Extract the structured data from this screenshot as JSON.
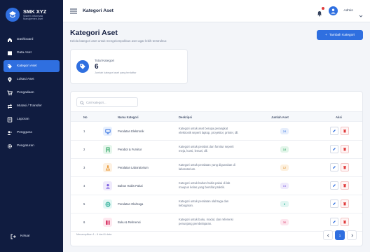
{
  "brand": {
    "name": "SMK XYZ",
    "subtitle_line1": "Sistem Informasi",
    "subtitle_line2": "Manajemen Aset"
  },
  "sidebar": {
    "items": [
      {
        "label": "Dashboard",
        "icon": "home-icon"
      },
      {
        "label": "Data Aset",
        "icon": "box-icon"
      },
      {
        "label": "Kategori Aset",
        "icon": "tag-icon",
        "active": true
      },
      {
        "label": "Lokasi Aset",
        "icon": "location-icon"
      },
      {
        "label": "Pengadaan",
        "icon": "cart-icon"
      },
      {
        "label": "Mutasi / Transfer",
        "icon": "transfer-icon"
      },
      {
        "label": "Laporan",
        "icon": "report-icon"
      },
      {
        "label": "Pengguna",
        "icon": "users-icon"
      },
      {
        "label": "Pengaturan",
        "icon": "gear-icon"
      }
    ],
    "logout": "Keluar"
  },
  "topbar": {
    "title": "Kategori Aset",
    "user": "Admin"
  },
  "page": {
    "title": "Kategori Aset",
    "subtitle": "Kelola kategori aset untuk mengelompokkan aset agar lebih terstruktur.",
    "add_button": "Tambah Kategori"
  },
  "stat": {
    "label": "Total Kategori",
    "value": "6",
    "desc": "Jumlah kategori aset yang terdaftar"
  },
  "search": {
    "placeholder": "Cari kategori..."
  },
  "table": {
    "headers": {
      "no": "No",
      "name": "Nama Kategori",
      "desc": "Deskripsi",
      "count": "Jumlah Aset",
      "actions": "Aksi"
    },
    "rows": [
      {
        "no": "1",
        "name": "Peralatan Elektronik",
        "desc": "Kategori untuk aset berupa perangkat elektronik seperti laptop, proyektor, printer, dll.",
        "count": "24",
        "icon_color": "#e8f0fe",
        "icon_fg": "#2f6fe0",
        "badge_bg": "#e6eefc",
        "badge_fg": "#2f6fe0"
      },
      {
        "no": "2",
        "name": "Perabot & Furnitur",
        "desc": "Kategori untuk perabot dan furnitur seperti meja, kursi, lemari, dll.",
        "count": "18",
        "icon_color": "#e6f6ec",
        "icon_fg": "#22a35a",
        "badge_bg": "#e2f5e9",
        "badge_fg": "#22a35a"
      },
      {
        "no": "3",
        "name": "Peralatan Laboratorium",
        "desc": "Kategori untuk peralatan yang digunakan di laboratorium.",
        "count": "12",
        "icon_color": "#fdf1e2",
        "icon_fg": "#e8942a",
        "badge_bg": "#fdf0de",
        "badge_fg": "#d9831c"
      },
      {
        "no": "4",
        "name": "Bahan Habis Pakai",
        "desc": "Kategori untuk bahan habis pakai di lab maupun kelas yang bersifat praktik.",
        "count": "15",
        "icon_color": "#efeafc",
        "icon_fg": "#7b5ce0",
        "badge_bg": "#efeafc",
        "badge_fg": "#7b5ce0"
      },
      {
        "no": "5",
        "name": "Peralatan Olahraga",
        "desc": "Kategori untuk peralatan olahraga dan kebugaran.",
        "count": "8",
        "icon_color": "#e3f7f4",
        "icon_fg": "#1da890",
        "badge_bg": "#e1f6f2",
        "badge_fg": "#1da890"
      },
      {
        "no": "6",
        "name": "Buku & Referensi",
        "desc": "Kategori untuk buku, modul, dan referensi penunjang pembelajaran.",
        "count": "30",
        "icon_color": "#fde8ef",
        "icon_fg": "#d93b6a",
        "badge_bg": "#fde6ee",
        "badge_fg": "#d93b6a"
      }
    ]
  },
  "footer": {
    "text": "Menampilkan 1 - 6 dari 6 data",
    "page": "1"
  },
  "colors": {
    "sidebar_bg": "#101c40",
    "accent": "#2f6fe0",
    "danger": "#e03b3b"
  }
}
